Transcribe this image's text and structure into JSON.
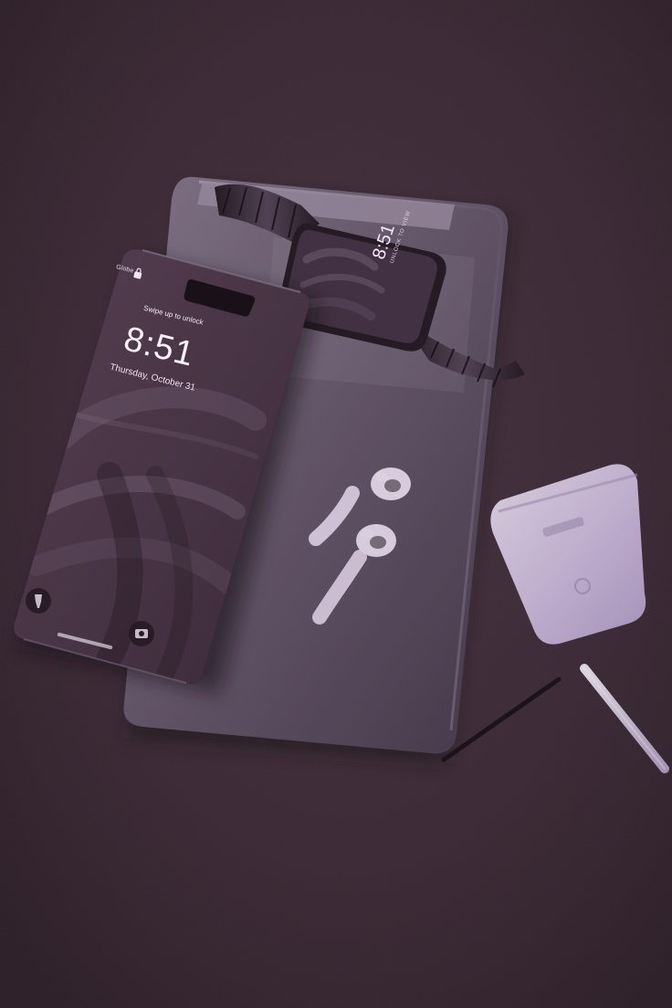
{
  "phone": {
    "carrier": "Globe",
    "swipe_text": "Swipe up to unlock",
    "time": "8:51",
    "date": "Thursday, October 31"
  },
  "watch": {
    "time": "8:51",
    "unlock_text": "UNLOCK TO VIEW"
  },
  "icons": {
    "phone_lock": "lock-icon",
    "phone_flashlight": "flashlight-icon",
    "phone_camera": "camera-icon"
  },
  "colors": {
    "background": "#3f2b38",
    "tablet": "#7a6b7f",
    "airpods": "#e5d5ef",
    "case": "#d9c7e6"
  }
}
